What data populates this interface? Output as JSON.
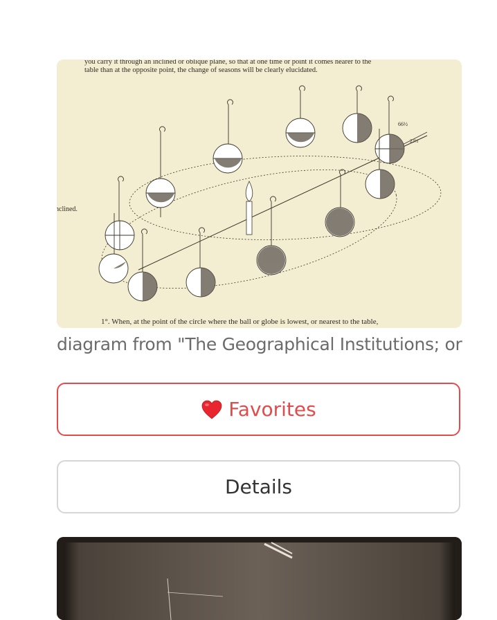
{
  "image_card": {
    "text_top_line1": "you carry it through an inclined or oblique plane, so that at one time or point it comes nearer to the",
    "text_top_line2": "table than at the opposite point, the change of seasons will be clearly elucidated.",
    "margin_word": "nclined.",
    "label_angle1": "66½",
    "label_angle2": "23½",
    "text_bottom": "1°. When, at the point of the circle where the ball or globe is lowest, or nearest to the table,"
  },
  "caption": "diagram from \"The Geographical Institutions; or",
  "favorites_button": {
    "icon": "heart-icon",
    "label": "Favorites",
    "color": "#e24b4b"
  },
  "details_button": {
    "label": "Details"
  },
  "colors": {
    "paper": "#f3edd2",
    "ink": "#3a3428",
    "accent": "#e24b4b",
    "border": "#d6d6d6"
  }
}
